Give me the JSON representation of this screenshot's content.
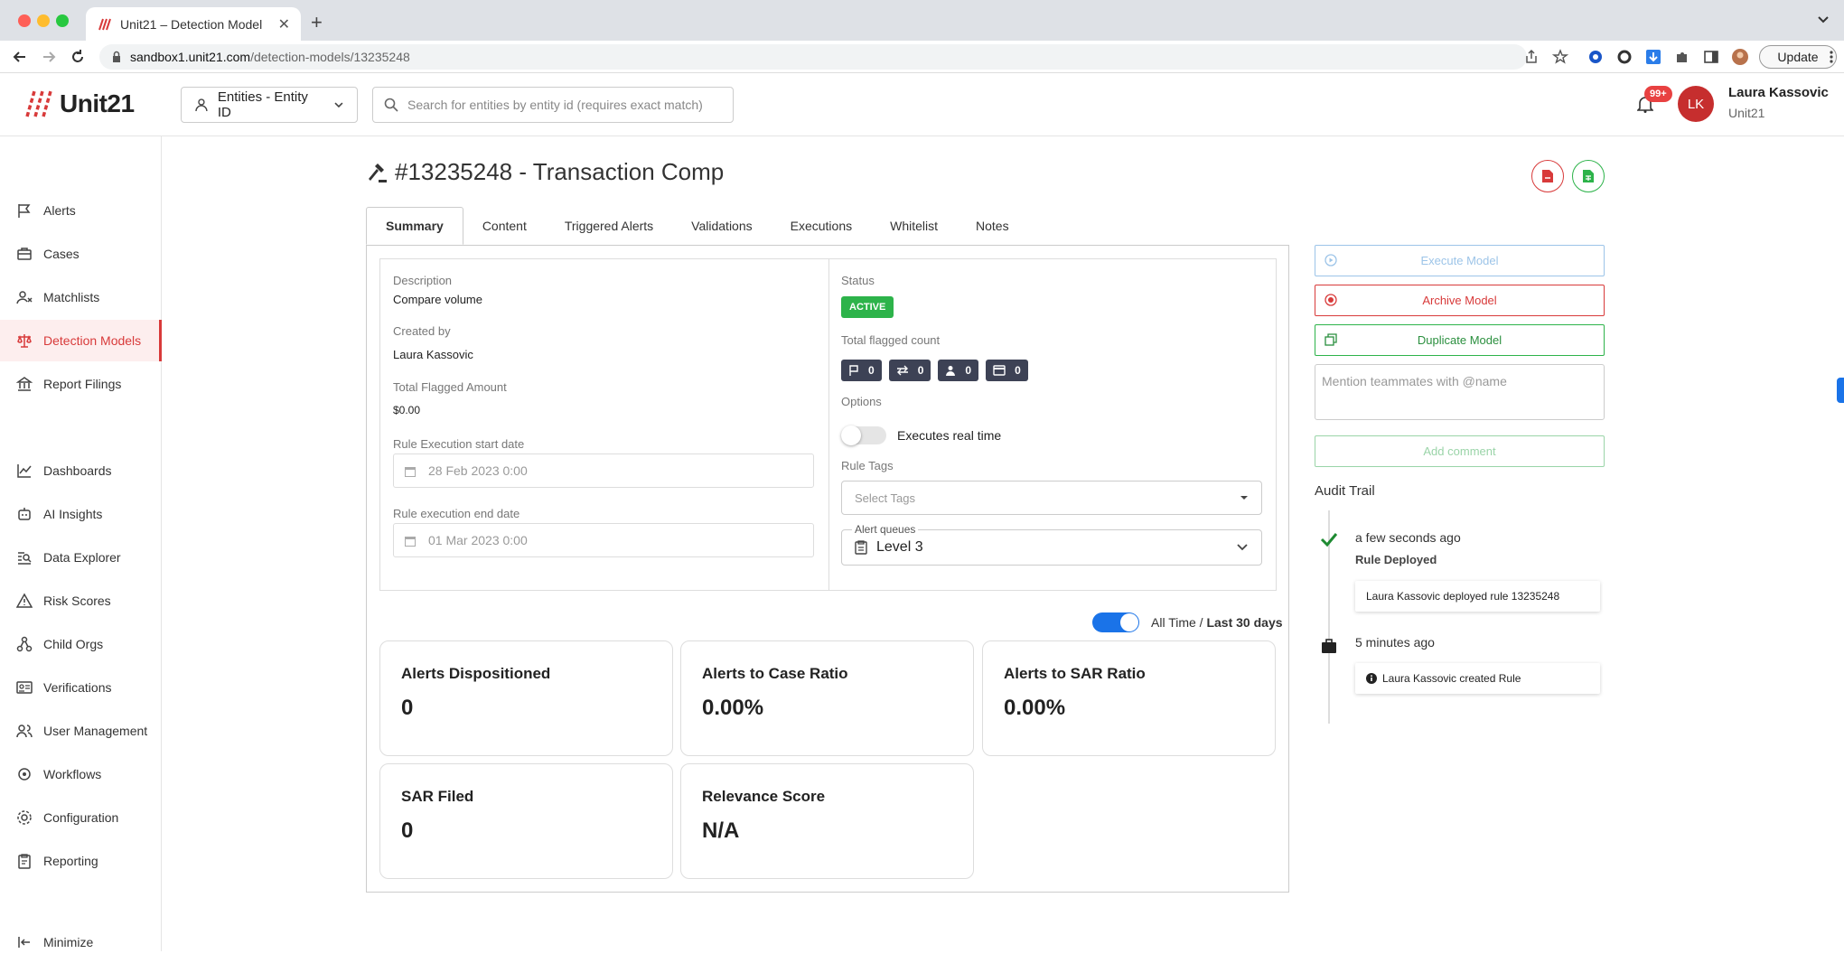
{
  "browser": {
    "tab_title": "Unit21 – Detection Model",
    "url_host": "sandbox1.unit21.com",
    "url_path": "/detection-models/13235248",
    "update_label": "Update"
  },
  "header": {
    "logo_text": "Unit21",
    "entity_select": "Entities - Entity ID",
    "search_placeholder": "Search for entities by entity id (requires exact match)",
    "notification_badge": "99+",
    "avatar_initials": "LK",
    "user_name": "Laura Kassovic",
    "user_org": "Unit21"
  },
  "sidebar": {
    "items": [
      {
        "label": "Alerts",
        "icon": "flag-icon"
      },
      {
        "label": "Cases",
        "icon": "briefcase-icon"
      },
      {
        "label": "Matchlists",
        "icon": "user-x-icon"
      },
      {
        "label": "Detection Models",
        "icon": "scale-icon"
      },
      {
        "label": "Report Filings",
        "icon": "bank-icon"
      },
      {
        "label": "Dashboards",
        "icon": "chart-line-icon"
      },
      {
        "label": "AI Insights",
        "icon": "robot-icon"
      },
      {
        "label": "Data Explorer",
        "icon": "search-list-icon"
      },
      {
        "label": "Risk Scores",
        "icon": "warning-icon"
      },
      {
        "label": "Child Orgs",
        "icon": "org-tree-icon"
      },
      {
        "label": "Verifications",
        "icon": "id-card-icon"
      },
      {
        "label": "User Management",
        "icon": "users-icon"
      },
      {
        "label": "Workflows",
        "icon": "workflow-icon"
      },
      {
        "label": "Configuration",
        "icon": "gear-icon"
      },
      {
        "label": "Reporting",
        "icon": "clipboard-icon"
      }
    ],
    "minimize_label": "Minimize"
  },
  "page": {
    "title": "#13235248 - Transaction Comp",
    "tabs": [
      "Summary",
      "Content",
      "Triggered Alerts",
      "Validations",
      "Executions",
      "Whitelist",
      "Notes"
    ]
  },
  "summary": {
    "description_label": "Description",
    "description_value": "Compare volume",
    "created_by_label": "Created by",
    "created_by_value": "Laura Kassovic",
    "flagged_amount_label": "Total Flagged Amount",
    "flagged_amount_value": "$0.00",
    "start_date_label": "Rule Execution start date",
    "start_date_value": "28 Feb 2023 0:00",
    "end_date_label": "Rule execution end date",
    "end_date_value": "01 Mar 2023 0:00",
    "status_label": "Status",
    "status_value": "ACTIVE",
    "flagged_count_label": "Total flagged count",
    "flagged_counts": [
      "0",
      "0",
      "0",
      "0"
    ],
    "options_label": "Options",
    "executes_realtime_label": "Executes real time",
    "rule_tags_label": "Rule Tags",
    "rule_tags_placeholder": "Select Tags",
    "alert_queues_label": "Alert queues",
    "alert_queues_value": "Level 3"
  },
  "time_range": {
    "all_time": "All Time /",
    "last_30": "Last 30 days"
  },
  "stats": [
    {
      "label": "Alerts Dispositioned",
      "value": "0"
    },
    {
      "label": "Alerts to Case Ratio",
      "value": "0.00%"
    },
    {
      "label": "Alerts to SAR Ratio",
      "value": "0.00%"
    },
    {
      "label": "SAR Filed",
      "value": "0"
    },
    {
      "label": "Relevance Score",
      "value": "N/A"
    }
  ],
  "actions": {
    "execute": "Execute Model",
    "archive": "Archive Model",
    "duplicate": "Duplicate Model",
    "comment_placeholder": "Mention teammates with @name",
    "add_comment": "Add comment"
  },
  "audit": {
    "title": "Audit Trail",
    "entries": [
      {
        "time": "a few seconds ago",
        "heading": "Rule Deployed",
        "text": "Laura Kassovic deployed rule 13235248"
      },
      {
        "time": "5 minutes ago",
        "text": "Laura Kassovic created Rule"
      }
    ]
  },
  "colors": {
    "brand_red": "#d83a3a",
    "active_green": "#2db34a",
    "toggle_blue": "#1a73e8",
    "chip_dark": "#3d4255"
  }
}
